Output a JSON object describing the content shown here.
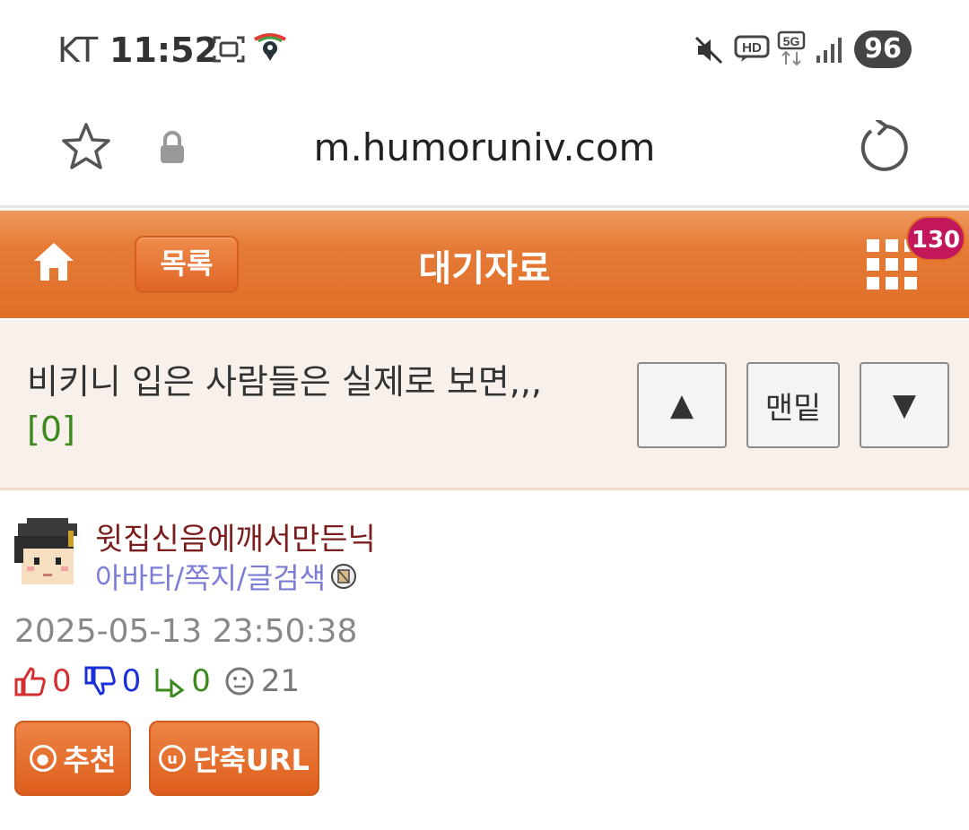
{
  "status_bar": {
    "carrier": "KT",
    "time": "11:52",
    "battery": "96",
    "icons": [
      "screenshot-icon",
      "map-pin-icon",
      "mute-icon",
      "hd-icon",
      "5g-icon",
      "signal-icon"
    ]
  },
  "browser": {
    "url": "m.humoruniv.com",
    "icons": [
      "star-icon",
      "lock-icon",
      "reload-icon"
    ]
  },
  "header": {
    "list_button": "목록",
    "title": "대기자료",
    "notification_count": "130",
    "background": "#e57a36",
    "badge_color": "#c2185b"
  },
  "post": {
    "title": "비키니 입은 사람들은 실제로 보면,,,",
    "comment_count": "[0]",
    "nav": {
      "up": "▲",
      "bottom": "맨밑",
      "down": "▼"
    },
    "author": {
      "nickname": "윗집신음에깨서만든닉",
      "links": "아바타/쪽지/글검색"
    },
    "date": "2025-05-13 23:50:38",
    "stats": {
      "upvotes": "0",
      "downvotes": "0",
      "shares": "0",
      "views": "21"
    },
    "actions": {
      "recommend": "추천",
      "short_url": "단축URL"
    }
  }
}
